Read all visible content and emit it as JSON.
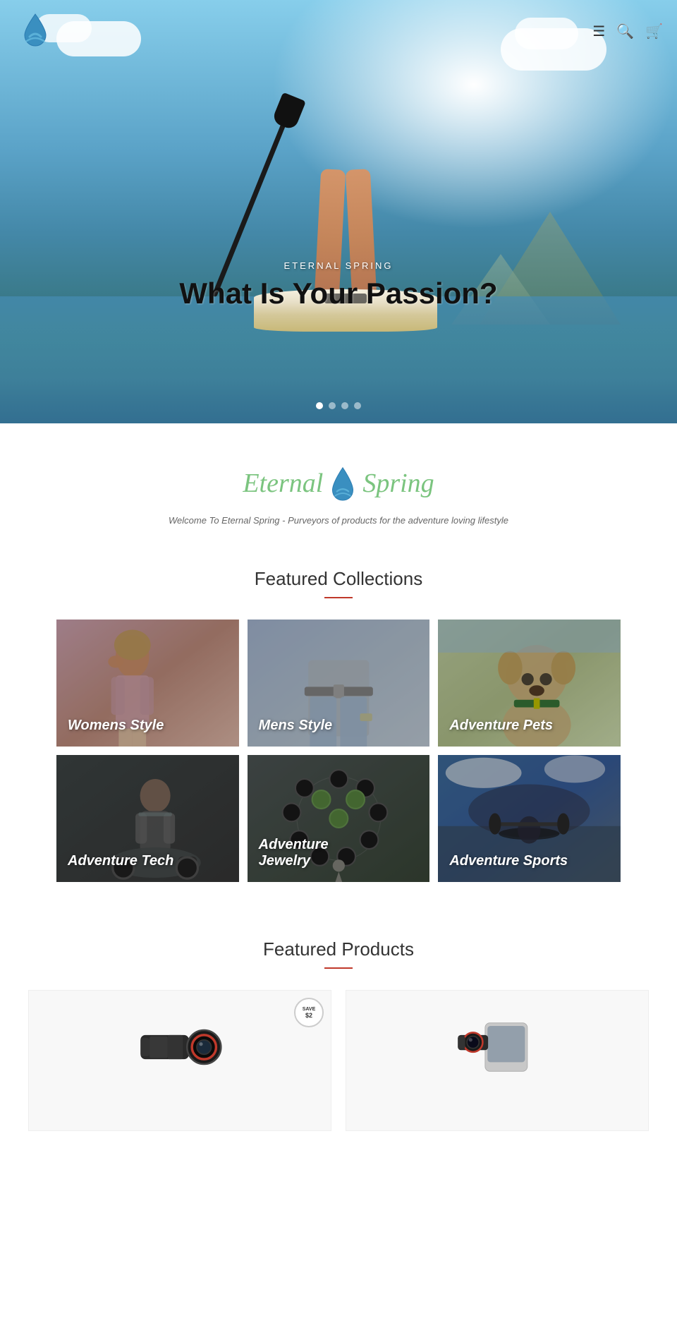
{
  "header": {
    "logo_alt": "Eternal Spring Logo",
    "icons": {
      "menu": "☰",
      "search": "🔍",
      "cart": "🛒"
    }
  },
  "hero": {
    "subtitle": "ETERNAL SPRING",
    "title": "What Is Your Passion?",
    "dots": [
      {
        "active": true
      },
      {
        "active": false
      },
      {
        "active": false
      },
      {
        "active": false
      }
    ]
  },
  "brand": {
    "name_left": "Eternal",
    "name_right": "Spring",
    "tagline": "Welcome To Eternal Spring - Purveyors of products for the adventure loving lifestyle"
  },
  "collections": {
    "section_title": "Featured Collections",
    "items": [
      {
        "label": "Womens Style",
        "bg_class": "bg-womens"
      },
      {
        "label": "Mens Style",
        "bg_class": "bg-mens"
      },
      {
        "label": "Adventure Pets",
        "bg_class": "bg-pets"
      },
      {
        "label": "Adventure Tech",
        "bg_class": "bg-tech"
      },
      {
        "label": "Adventure Jewelry",
        "bg_class": "bg-jewelry"
      },
      {
        "label": "Adventure Sports",
        "bg_class": "bg-sports"
      }
    ]
  },
  "products": {
    "section_title": "Featured Products",
    "save_label": "SAVE",
    "save_amount": "$2"
  }
}
